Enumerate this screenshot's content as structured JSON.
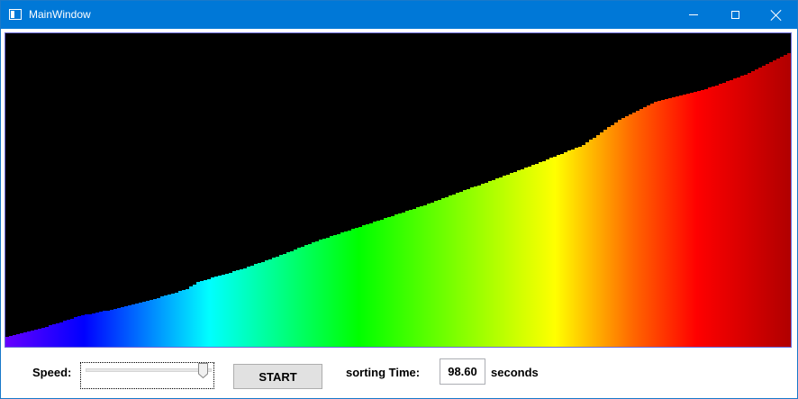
{
  "window": {
    "title": "MainWindow",
    "controls": [
      "minimize-icon",
      "maximize-icon",
      "close-icon"
    ],
    "titlebar_color": "#0078d7"
  },
  "visualization": {
    "description_colors": [
      "#6600ff",
      "#0000ff",
      "#00ffff",
      "#00ff00",
      "#ffff00",
      "#ff6600",
      "#ff0000",
      "#b00000"
    ],
    "background": "#000000"
  },
  "controls": {
    "speed_label": "Speed:",
    "speed_value": 0.97,
    "start_label": "START",
    "sorting_time_label": "sorting Time:",
    "sorting_time_value": "98.60",
    "seconds_label": "seconds"
  }
}
